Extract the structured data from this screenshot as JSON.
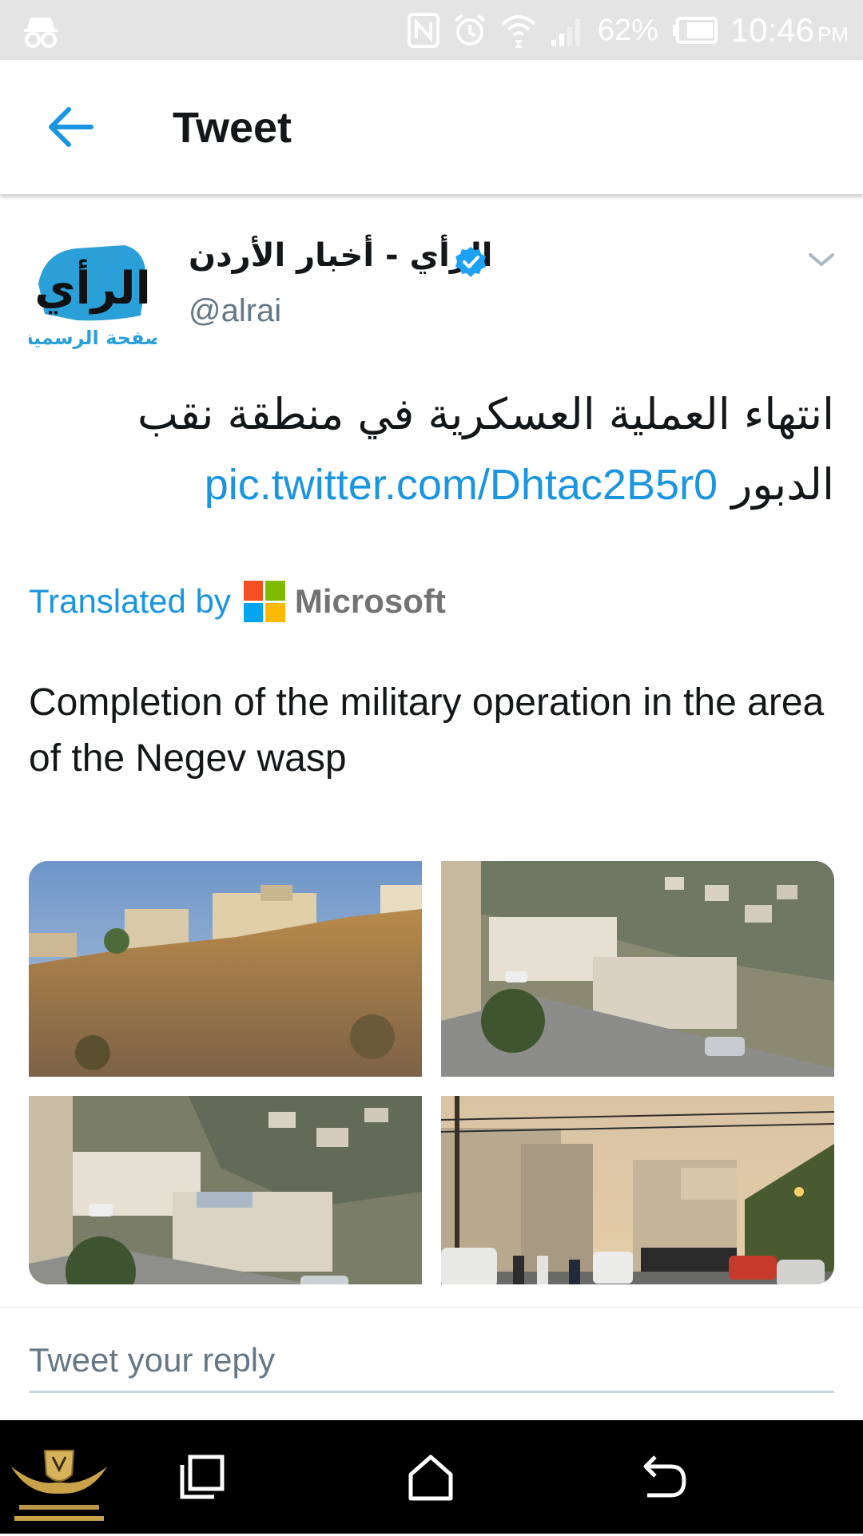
{
  "status_bar": {
    "battery_percent": "62%",
    "time": "10:46",
    "am_pm": "PM",
    "icons": [
      "incognito-icon",
      "nfc-icon",
      "alarm-icon",
      "wifi-icon",
      "signal-icon",
      "battery-icon"
    ]
  },
  "app_bar": {
    "title": "Tweet",
    "back_icon": "arrow-left-icon"
  },
  "tweet": {
    "author_name": "الرأي - أخبار الأردن",
    "handle": "@alrai",
    "verified": true,
    "avatar_logo_text": "الرأي",
    "avatar_logo_subtext": "صفحة الرسمية",
    "text": "انتهاء العملية العسكرية في منطقة نقب الدبور",
    "link": "pic.twitter.com/Dhtac2B5r0",
    "translated_by_label": "Translated by",
    "translator_name": "Microsoft",
    "translation": "Completion of the military operation in the area of the Negev wasp",
    "media_count": 4
  },
  "reply": {
    "placeholder": "Tweet your reply"
  },
  "nav_bar": {
    "buttons": [
      "recent-apps-icon",
      "home-icon",
      "back-icon"
    ]
  },
  "colors": {
    "accent": "#1b95e0",
    "text": "#14171a",
    "secondary_text": "#657786",
    "verified": "#1da1f2",
    "status_bar": "#e4e4e4",
    "nav_bar": "#000000",
    "ms_red": "#f25022",
    "ms_green": "#7fba00",
    "ms_blue": "#00a4ef",
    "ms_yellow": "#ffb900"
  }
}
